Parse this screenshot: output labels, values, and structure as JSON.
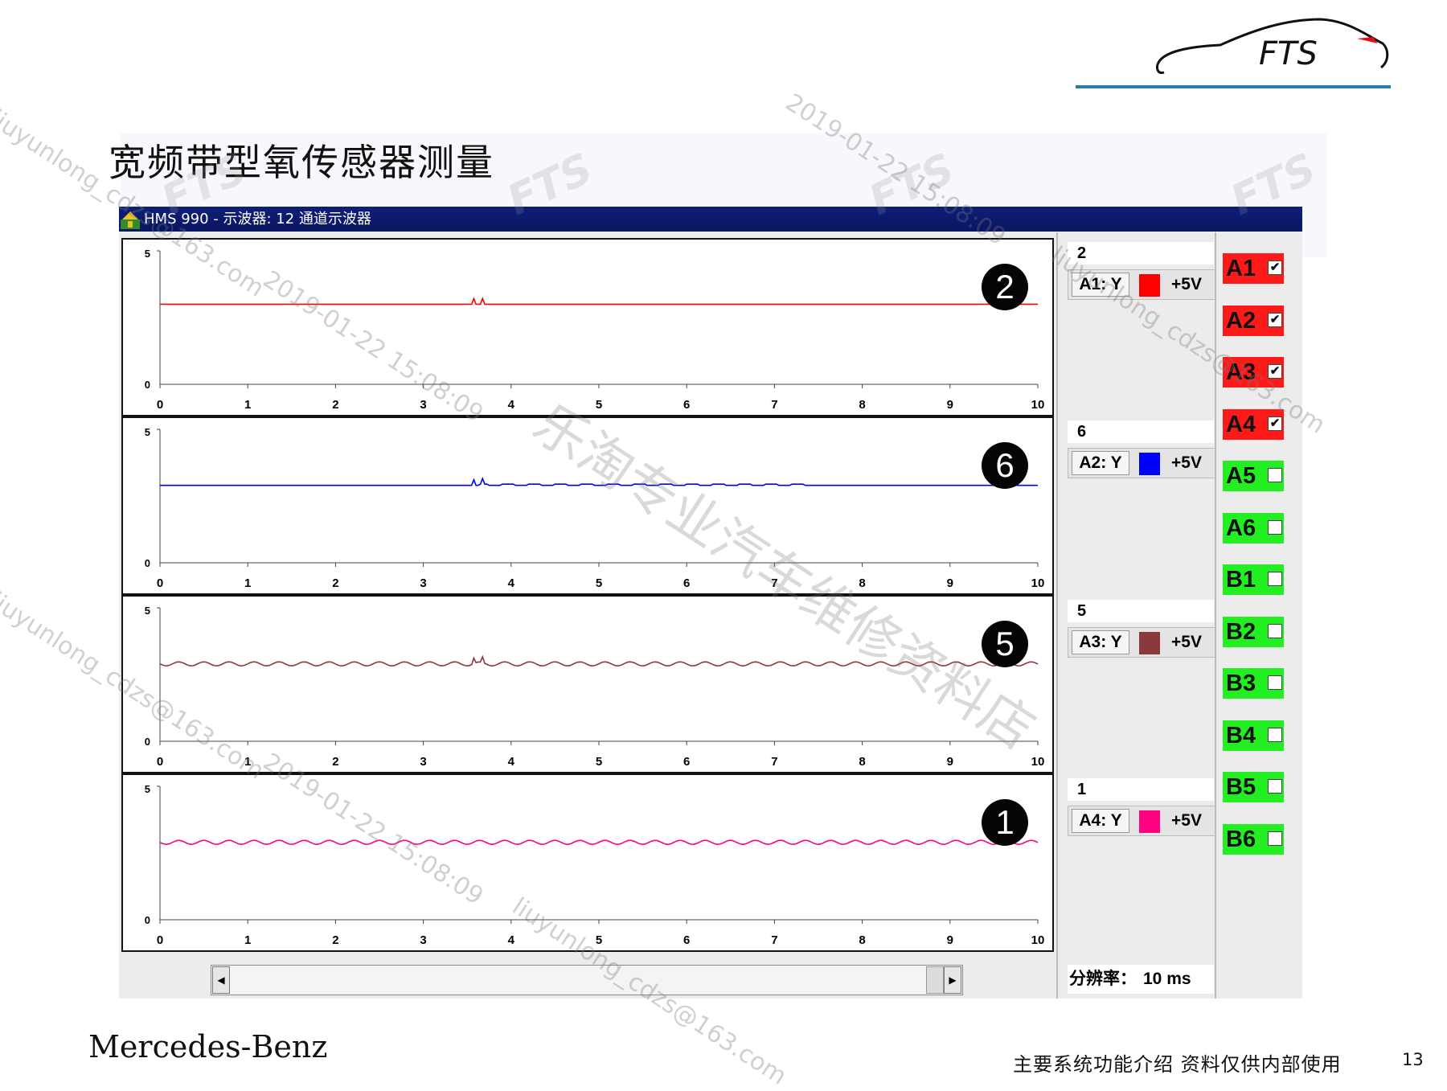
{
  "slide": {
    "title": "宽频带型氧传感器测量",
    "brand": "Mercedes-Benz",
    "footer": "主要系统功能介绍  资料仅供内部使用",
    "page_number": "13",
    "logo_text": "FTS"
  },
  "window": {
    "title": "HMS 990 - 示波器: 12 通道示波器"
  },
  "axis": {
    "x_ticks": [
      "0",
      "1",
      "2",
      "3",
      "4",
      "5",
      "6",
      "7",
      "8",
      "9",
      "10"
    ],
    "y_max_label": "5",
    "y_min_label": "0"
  },
  "channels": [
    {
      "badge": "2",
      "number": "2",
      "label": "A1: Y",
      "range": "+5V",
      "color": "#ff0000"
    },
    {
      "badge": "6",
      "number": "6",
      "label": "A2: Y",
      "range": "+5V",
      "color": "#0000ff"
    },
    {
      "badge": "5",
      "number": "5",
      "label": "A3: Y",
      "range": "+5V",
      "color": "#8b3a3a"
    },
    {
      "badge": "1",
      "number": "1",
      "label": "A4: Y",
      "range": "+5V",
      "color": "#ff0080"
    }
  ],
  "resolution": {
    "label": "分辨率：",
    "value": "10 ms"
  },
  "channel_buttons": [
    {
      "label": "A1",
      "checked": true,
      "color": "#ff1a1a"
    },
    {
      "label": "A2",
      "checked": true,
      "color": "#ff1a1a"
    },
    {
      "label": "A3",
      "checked": true,
      "color": "#ff1a1a"
    },
    {
      "label": "A4",
      "checked": true,
      "color": "#ff1a1a"
    },
    {
      "label": "A5",
      "checked": false,
      "color": "#22ee22"
    },
    {
      "label": "A6",
      "checked": false,
      "color": "#22ee22"
    },
    {
      "label": "B1",
      "checked": false,
      "color": "#22ee22"
    },
    {
      "label": "B2",
      "checked": false,
      "color": "#22ee22"
    },
    {
      "label": "B3",
      "checked": false,
      "color": "#22ee22"
    },
    {
      "label": "B4",
      "checked": false,
      "color": "#22ee22"
    },
    {
      "label": "B5",
      "checked": false,
      "color": "#22ee22"
    },
    {
      "label": "B6",
      "checked": false,
      "color": "#22ee22"
    }
  ],
  "watermarks": {
    "email": "liuyunlong_cdzs@163.com",
    "timestamp": "2019-01-22 15:08:09",
    "shop": "乐淘专业汽车维修资料店",
    "fts": "FTS"
  }
}
